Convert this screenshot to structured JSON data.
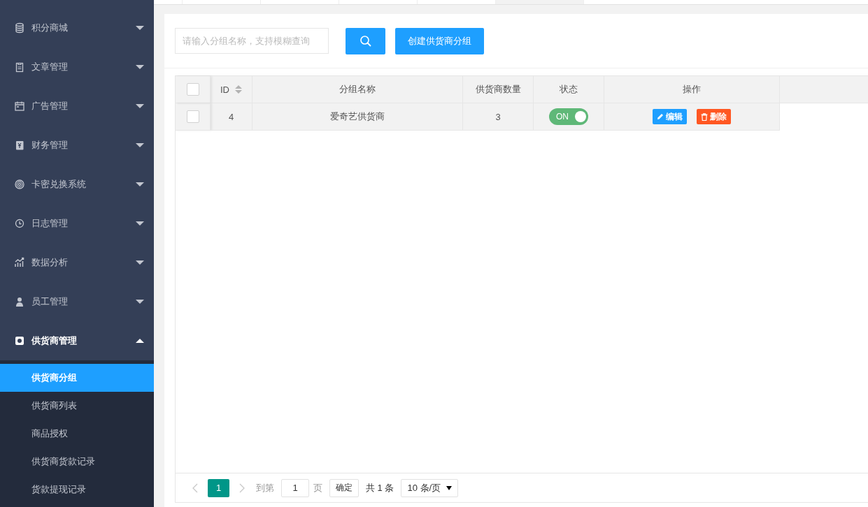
{
  "sidebar": {
    "items": [
      {
        "label": "积分商城",
        "expanded": false
      },
      {
        "label": "文章管理",
        "expanded": false
      },
      {
        "label": "广告管理",
        "expanded": false
      },
      {
        "label": "财务管理",
        "expanded": false
      },
      {
        "label": "卡密兑换系统",
        "expanded": false
      },
      {
        "label": "日志管理",
        "expanded": false
      },
      {
        "label": "数据分析",
        "expanded": false
      },
      {
        "label": "员工管理",
        "expanded": false
      },
      {
        "label": "供货商管理",
        "expanded": true,
        "children": [
          {
            "label": "供货商分组",
            "selected": true
          },
          {
            "label": "供货商列表",
            "selected": false
          },
          {
            "label": "商品授权",
            "selected": false
          },
          {
            "label": "供货商货款记录",
            "selected": false
          },
          {
            "label": "货款提现记录",
            "selected": false
          }
        ]
      }
    ]
  },
  "toolbar": {
    "search": {
      "placeholder": "请输入分组名称，支持模糊查询"
    },
    "create_button": "创建供货商分组"
  },
  "table": {
    "select_all": {
      "checked": false
    },
    "columns": [
      "ID",
      "分组名称",
      "供货商数量",
      "状态",
      "操作"
    ],
    "rows": [
      {
        "checked": false,
        "id": "4",
        "name": "爱奇艺供货商",
        "count": "3",
        "status": {
          "on": true,
          "label": "ON"
        },
        "actions": [
          "编辑",
          "删除"
        ]
      }
    ]
  },
  "pagination": {
    "pages": [
      {
        "label": "1",
        "selected": true
      }
    ],
    "prev_disabled": true,
    "goto_label": "到第",
    "goto_value": "1",
    "page_unit": "页",
    "confirm": "确定",
    "total": "共 1 条",
    "page_size": "10 条/页"
  }
}
